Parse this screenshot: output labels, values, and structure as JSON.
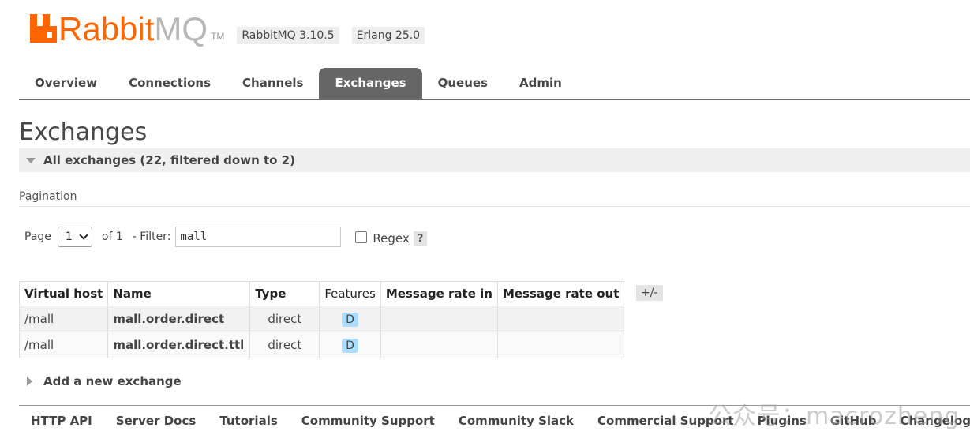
{
  "header": {
    "logo_primary": "Rabbit",
    "logo_secondary": "MQ",
    "logo_tm": "TM",
    "version_badge": "RabbitMQ 3.10.5",
    "erlang_badge": "Erlang 25.0"
  },
  "nav": {
    "tabs": [
      {
        "label": "Overview",
        "active": false
      },
      {
        "label": "Connections",
        "active": false
      },
      {
        "label": "Channels",
        "active": false
      },
      {
        "label": "Exchanges",
        "active": true
      },
      {
        "label": "Queues",
        "active": false
      },
      {
        "label": "Admin",
        "active": false
      }
    ]
  },
  "main": {
    "title": "Exchanges",
    "section_header": "All exchanges (22, filtered down to 2)",
    "pagination_label": "Pagination",
    "pager": {
      "page_label": "Page",
      "page_value": "1",
      "of_label": "of 1",
      "filter_label": "- Filter:",
      "filter_value": "mall",
      "regex_label": "Regex",
      "help_label": "?"
    },
    "table": {
      "columns": [
        "Virtual host",
        "Name",
        "Type",
        "Features",
        "Message rate in",
        "Message rate out"
      ],
      "column_toggle": "+/-",
      "rows": [
        {
          "vhost": "/mall",
          "name": "mall.order.direct",
          "type": "direct",
          "feature": "D",
          "rate_in": "",
          "rate_out": ""
        },
        {
          "vhost": "/mall",
          "name": "mall.order.direct.ttl",
          "type": "direct",
          "feature": "D",
          "rate_in": "",
          "rate_out": ""
        }
      ]
    },
    "add_exchange_label": "Add a new exchange"
  },
  "footer": {
    "links": [
      "HTTP API",
      "Server Docs",
      "Tutorials",
      "Community Support",
      "Community Slack",
      "Commercial Support",
      "Plugins",
      "GitHub",
      "Changelog"
    ]
  },
  "watermark": "公众号：macrozheng",
  "colors": {
    "brand_orange": "#ff6600",
    "active_tab_bg": "#666666",
    "feature_badge": "#aaddff"
  }
}
